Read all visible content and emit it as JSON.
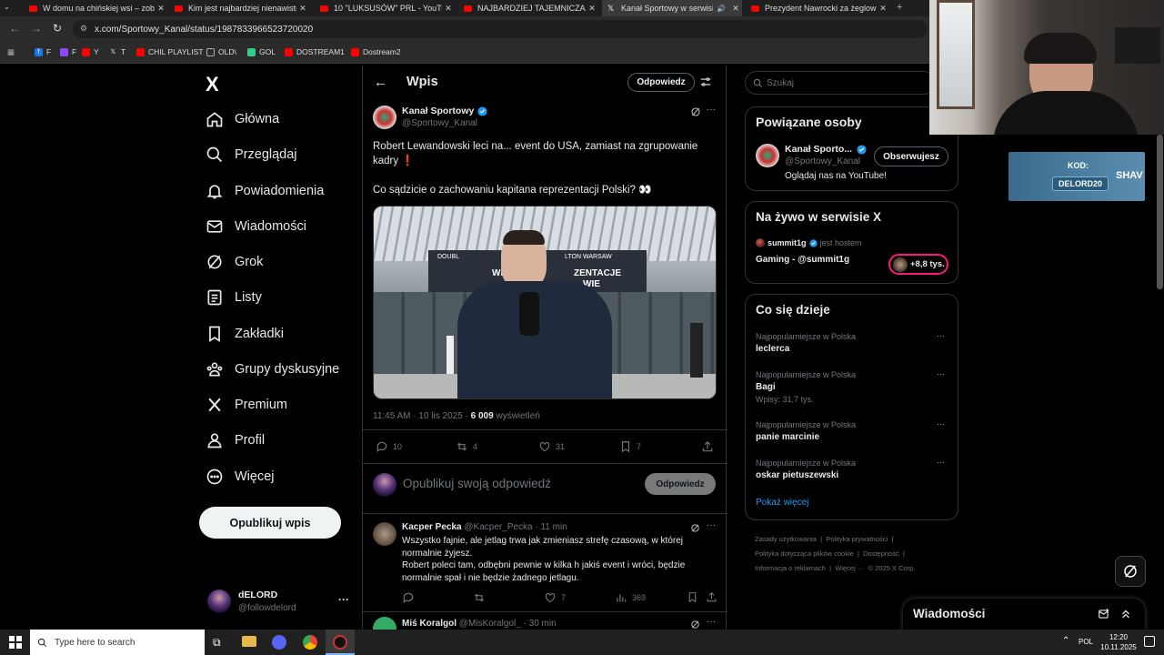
{
  "browser": {
    "tabs": [
      {
        "label": "W domu na chińskiej wsi – zob",
        "type": "yt"
      },
      {
        "label": "Kim jest najbardziej nienawistn",
        "type": "yt"
      },
      {
        "label": "10 \"LUKSUSÓW\" PRL - YouTube",
        "type": "yt"
      },
      {
        "label": "NAJBARDZIEJ TAJEMNICZA MA",
        "type": "yt"
      },
      {
        "label": "Kanał Sportowy w serwisie",
        "type": "x"
      },
      {
        "label": "Prezydent Nawrocki za żeglow",
        "type": "yt"
      }
    ],
    "url": "x.com/Sportowy_Kanal/status/1987833966523720020",
    "bookmarks": [
      "F",
      "F",
      "Y",
      "T",
      "CHIL PLAYLIST",
      "OLD\\",
      "GOL",
      "DOSTREAM1",
      "Dostream2"
    ]
  },
  "nav": {
    "logo": "X",
    "items": [
      "Główna",
      "Przeglądaj",
      "Powiadomienia",
      "Wiadomości",
      "Grok",
      "Listy",
      "Zakładki",
      "Grupy dyskusyjne",
      "Premium",
      "Profil",
      "Więcej"
    ],
    "post_button": "Opublikuj wpis",
    "account_name": "dELORD",
    "account_handle": "@followdelord"
  },
  "header": {
    "title": "Wpis",
    "reply_button": "Odpowiedz"
  },
  "tweet": {
    "author": "Kanał Sportowy",
    "handle": "@Sportowy_Kanal",
    "text1": "Robert Lewandowski leci na... event do USA, zamiast na zgrupowanie kadry ❗",
    "text2": "Co sądzicie o zachowaniu kapitana reprezentacji Polski? 👀",
    "time": "11:45 AM · 10 lis 2025 · ",
    "views": "6 009",
    "views_label": " wyświetleń",
    "image_signs": {
      "hotel_top": "DOUBL",
      "hotel_top2": "LTON WARSAW",
      "banner1": "WITA",
      "banner2": "ZENTACJE",
      "banner3": "WIE"
    },
    "replies": "10",
    "reposts": "4",
    "likes": "31",
    "bookmarks": "7"
  },
  "compose": {
    "placeholder": "Opublikuj swoją odpowiedź",
    "button": "Odpowiedz"
  },
  "replies": [
    {
      "author": "Kacper Pecka",
      "handle": "@Kacper_Pecka",
      "time": "· 11 min",
      "text1": "Wszystko fajnie, ale jetlag trwa jak zmieniasz strefę czasową, w której normalnie żyjesz.",
      "text2": "Robert poleci tam, odbębni pewnie w kilka h jakiś event i wróci, będzie normalnie spał i nie będzie żadnego jetlagu.",
      "likes": "7",
      "views": "369"
    },
    {
      "author": "Miś Koralgol",
      "handle": "@MisKoralgol_",
      "time": "· 30 min"
    }
  ],
  "search": {
    "placeholder": "Szukaj"
  },
  "related": {
    "title": "Powiązane osoby",
    "name": "Kanał Sporto...",
    "handle": "@Sportowy_Kanal",
    "bio": "Oglądaj nas na YouTube!",
    "follow_button": "Obserwujesz"
  },
  "live": {
    "title": "Na żywo w serwisie X",
    "host": "summit1g",
    "host_suffix": "jest hostem",
    "stream": "Gaming - @summit1g",
    "count": "+8,8 tys."
  },
  "trends": {
    "title": "Co się dzieje",
    "items": [
      {
        "context": "Najpopularniejsze w Polska",
        "name": "leclerca",
        "posts": ""
      },
      {
        "context": "Najpopularniejsze w Polska",
        "name": "Bagi",
        "posts": "Wpisy: 31,7 tys."
      },
      {
        "context": "Najpopularniejsze w Polska",
        "name": "panie marcinie",
        "posts": ""
      },
      {
        "context": "Najpopularniejsze w Polska",
        "name": "oskar pietuszewski",
        "posts": ""
      }
    ],
    "more": "Pokaż więcej"
  },
  "footer": {
    "l1a": "Zasady użytkowania",
    "l1b": "Polityka prywatności",
    "l2a": "Polityka dotycząca plików cookie",
    "l2b": "Dostępność",
    "l3a": "Informacja o reklamach",
    "l3b": "Więcej ···",
    "l3c": "© 2025 X Corp."
  },
  "overlay": {
    "code_label": "KOD:",
    "code": "DELORD20",
    "brand": "SHAV"
  },
  "messages_drawer": {
    "title": "Wiadomości"
  },
  "taskbar": {
    "search_placeholder": "Type here to search",
    "lang": "POL",
    "time": "12:20",
    "date": "10.11.2025"
  },
  "colors": {
    "accent": "#1d9bf0",
    "bg": "#000000",
    "border": "#2f3336",
    "muted": "#71767b",
    "live_pink": "#f91880"
  }
}
